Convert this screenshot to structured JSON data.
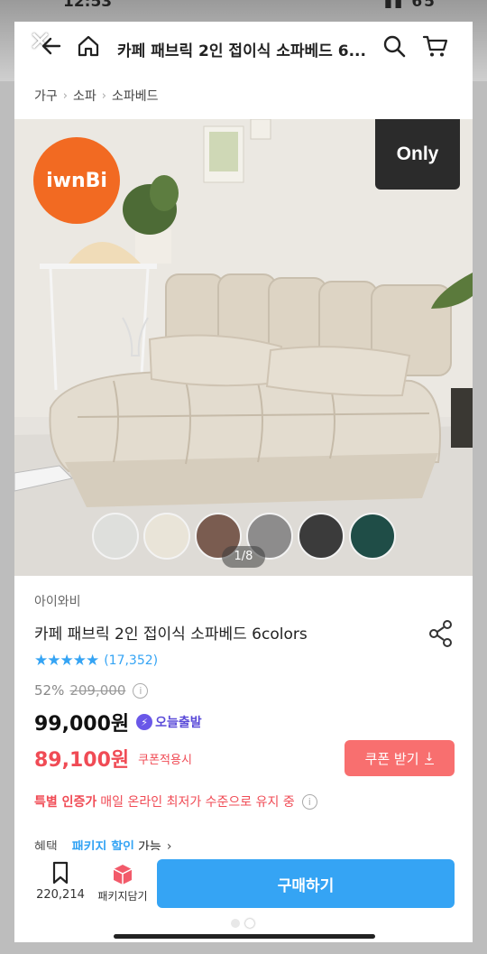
{
  "header": {
    "title": "카페 패브릭 2인 접이식 소파베드 6..."
  },
  "breadcrumb": [
    "가구",
    "소파",
    "소파베드"
  ],
  "image": {
    "brand_logo_text": "iwnBi",
    "badge_text": "Only",
    "pager": "1/8",
    "swatch_colors": [
      "#dedfdc",
      "#e9e4d8",
      "#7a5c50",
      "#8d8c8c",
      "#3b3b3b",
      "#1f4d47"
    ]
  },
  "product": {
    "brand": "아이와비",
    "title": "카페 패브릭 2인 접이식 소파베드 6colors",
    "stars": "★★★★★",
    "rating": 4.7,
    "review_count": "(17,352)",
    "discount": "52%",
    "original_price": "209,000",
    "sale_price": "99,000원",
    "today_badge": "오늘출발",
    "coupon_price": "89,100원",
    "coupon_note": "쿠폰적용시",
    "coupon_button": "쿠폰 받기",
    "notice_highlight": "특별 인증가",
    "notice_text": "매일 온라인 최저가 수준으로 유지 중",
    "benefit_label": "혜택",
    "benefit_link": "패키지 할인",
    "benefit_avail": "가능"
  },
  "bottom_bar": {
    "save_count": "220,214",
    "package_label": "패키지담기",
    "buy_label": "구매하기"
  },
  "colors": {
    "accent_blue": "#35a4f4",
    "coupon_red": "#f04b55",
    "coupon_button": "#f86f6f",
    "brand_orange": "#f26a22"
  }
}
